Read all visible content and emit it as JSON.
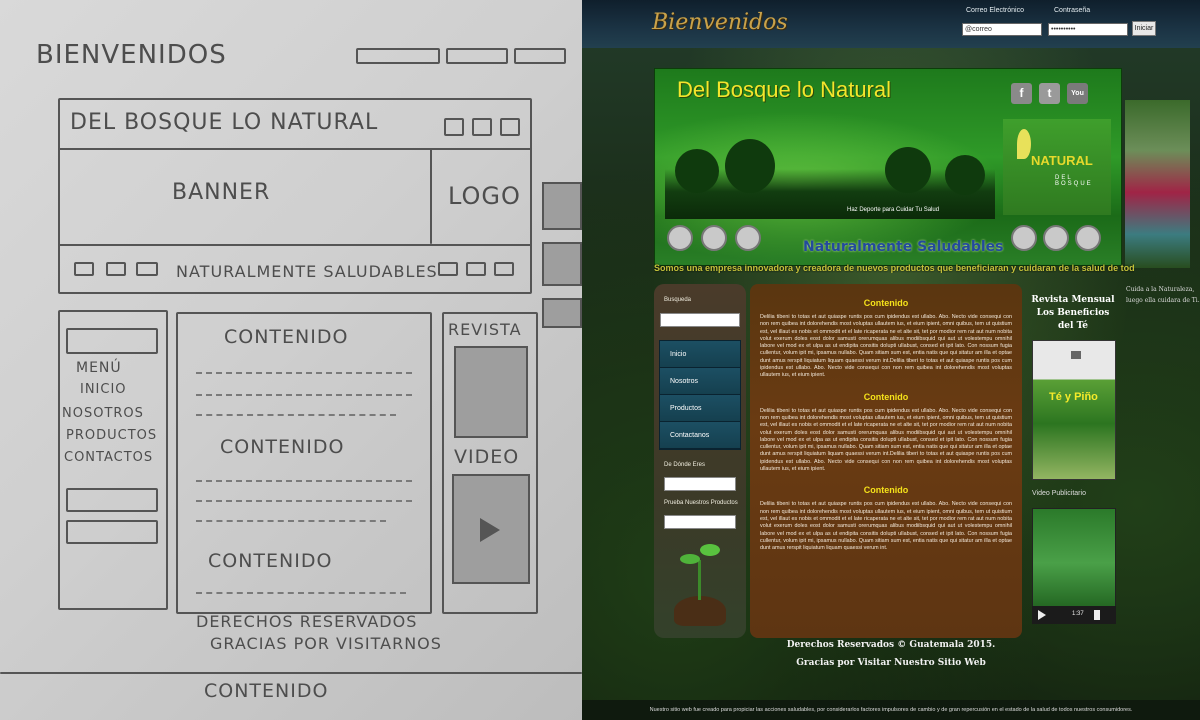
{
  "sketch": {
    "welcome": "BIENVENIDOS",
    "banner_title": "DEL BOSQUE LO NATURAL",
    "banner": "BANNER",
    "logo": "LOGO",
    "slogan": "NATURALMENTE SALUDABLES",
    "menu": "MENÚ",
    "menu_items": [
      "INICIO",
      "NOSOTROS",
      "PRODUCTOS",
      "CONTACTOS"
    ],
    "content": "CONTENIDO",
    "revista": "REVISTA",
    "video": "VIDEO",
    "footer_1": "DERECHOS RESERVADOS",
    "footer_2": "GRACIAS POR VISITARNOS",
    "bottom": "CONTENIDO"
  },
  "site": {
    "logo_text": "Bienvenidos",
    "login": {
      "email_label": "Correo Electrónico",
      "password_label": "Contraseña",
      "email_value": "@correo",
      "password_value": "••••••••••",
      "submit": "Iniciar"
    },
    "banner": {
      "title": "Del Bosque lo Natural",
      "sub": "Haz Deporte para Cuidar Tu Salud",
      "slogan": "Naturalmente Saludables",
      "logo_main": "NATURAL",
      "logo_sub": "DEL BOSQUE",
      "social": [
        "f",
        "t",
        "You"
      ]
    },
    "tagline": "Somos una empresa innovadora y creadora de nuevos productos que beneficiaran y cuidaran de la salud de todos",
    "side_quote": [
      "Cuida a la Naturaleza,",
      "luego ella cuidara de Ti."
    ],
    "sidebar": {
      "search_label": "Busqueda",
      "menu": [
        "Inicio",
        "Nosotros",
        "Productos",
        "Contactanos"
      ],
      "where_label": "De Dónde Eres",
      "try_label": "Prueba Nuestros Productos"
    },
    "content": {
      "sections": [
        {
          "heading": "Contenido",
          "body": "Delilia tibeni to totas et aut quiaspe runtis pos cum ipidendus est ullabo. Abo. Necto vide consequi con non rem quibea int dolorehendis most voluptas ullautem ius, et eium ipient, omni quibus, tem ut quistium est, vel illaut es nobis et ommodit et el late ricaperata ne et alte sit, tet por modior rem rat aut num nobita volut exerum doles eost dolor samusti orerumquas alibus modiibsquid qui aut ut volestempu omnihil labore vel mod ex et ulpa as ut endipita consitis dolupti ullabust, consed et ipit lato. Con nossum fugia cullentur, volum ipit mi, ipsamus nullabo. Quam sitiam sum est, entia natis que qui sitatur am illa et optae dunt amus rerspit liquiatum liquam quaessi verum int.Delilia tiberi to totas et aut quiaspe runtis pos cum ipidendus est ullabo. Abo. Necto vide consequi con non rem quibea int dolorehendis most voluptas ullautem ius, et eium ipient."
        },
        {
          "heading": "Contenido",
          "body": "Delilia tibeni to totas et aut quiaspe runtis pos cum ipidendus est ullabo. Abo. Necto vide consequi con non rem quibea int dolorehendis most voluptas ullautem ius, et eium ipient, omni quibus, tem ut quistium est, vel illaut es nobis et ommodit et el late ricaperata ne et alte sit, tet por modior rem rat aut num nobita volut exerum doles eost dolor samusti orerumquas alibus modiibsquid qui aut ut volestempu omnihil labore vel mod ex et ulpa as ut endipita consitis dolupti ullabust, consed et ipit lato. Con nossum fugia cullentur, volum ipit mi, ipsamus nullabo. Quam sitiam sum est, entia natis que qui sitatur am illa et optae dunt amus rerspit liquiatum liquam quaessi verum int.Delilia tiberi to totas et aut quiaspe runtis pos cum ipidendus est ullabo. Abo. Necto vide consequi con non rem quibea int dolorehendis most voluptas ullautem ius, et eium ipient."
        },
        {
          "heading": "Contenido",
          "body": "Delilia tibeni to totas et aut quiaspe runtis pos cum ipidendus est ullabo. Abo. Necto vide consequi con non rem quibea int dolorehendis most voluptas ullautem ius, et eium ipient, omni quibus, tem ut quistium est, vel illaut es nobis et ommodit et el late ricaperata ne et alte sit, tet por modior rem rat aut num nobita volut exerum doles eost dolor samusti orerumquas alibus modiibsquid qui aut ut volestempu omnihil labore vel mod ex et ulpa as ut endipita consitis dolupti ullabust, consed et ipit lato. Con nossum fugia cullentur, volum ipit mi, ipsamus nullabo. Quam sitiam sum est, entia natis que qui sitatur am illa et optae dunt amus rerspit liquiatum liquam quaessi verum int."
        }
      ]
    },
    "right": {
      "title": "Revista Mensual Los Beneficios del Té",
      "mag_title": "Té y Piño",
      "video_label": "Video Publicitario",
      "video_time": "1:37"
    },
    "footer": {
      "line1": "Derechos Reservados © Guatemala 2015.",
      "line2": "Gracias por Visitar Nuestro Sitio Web",
      "bottom": "Nuestro sitio web fue creado para propiciar las acciones saludables, por considerarlos factores impulsores de cambio y de gran repercusión en el estado de la salud de todos nuestros consumidores."
    }
  }
}
